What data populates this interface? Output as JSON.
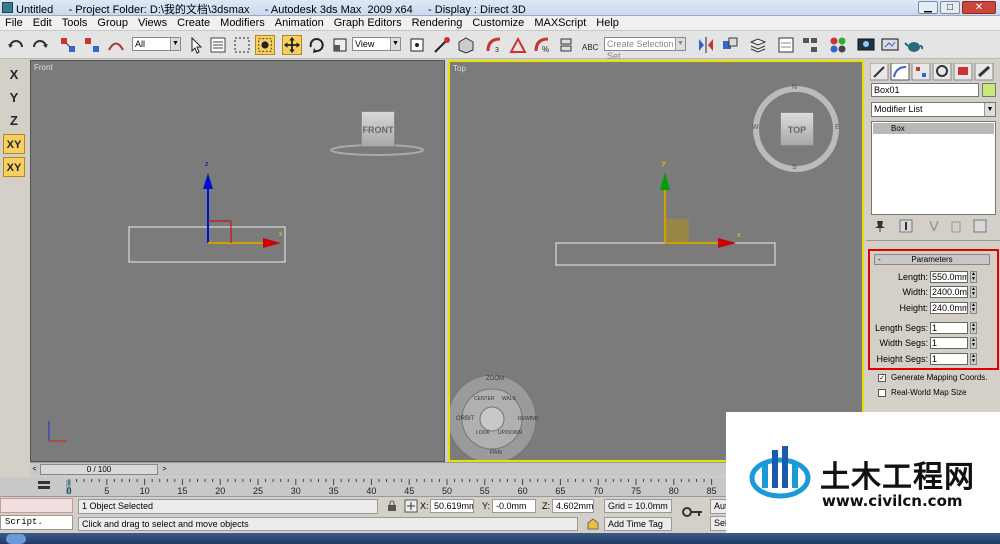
{
  "window": {
    "title": "Untitled     - Project Folder: D:\\我的文档\\3dsmax     - Autodesk 3ds Max  2009 x64     - Display : Direct 3D"
  },
  "menu": [
    "File",
    "Edit",
    "Tools",
    "Group",
    "Views",
    "Create",
    "Modifiers",
    "Animation",
    "Graph Editors",
    "Rendering",
    "Customize",
    "MAXScript",
    "Help"
  ],
  "toolbar": {
    "filter_value": "All",
    "ref_coord_value": "View",
    "named_selection_placeholder": "Create Selection Set"
  },
  "axis_constraints": [
    "X",
    "Y",
    "Z",
    "XY",
    "XY"
  ],
  "viewports": {
    "front": {
      "label": "Front",
      "cube_label": "FRONT",
      "axis_x": "x",
      "axis_z": "z"
    },
    "top": {
      "label": "Top",
      "cube_label": "TOP",
      "compass": [
        "N",
        "E",
        "S",
        "W"
      ],
      "axis_x": "x",
      "axis_y": "y"
    }
  },
  "steering_wheel": {
    "items": [
      "ZOOM",
      "ORBIT",
      "CENTER",
      "WALK",
      "REWIND",
      "LOOK",
      "UP/DOWN",
      "PAN"
    ]
  },
  "command_panel": {
    "object_name": "Box01",
    "object_color": "#c8e87a",
    "modifier_list_label": "Modifier List",
    "stack_item": "Box",
    "rollout_title": "Parameters",
    "rollout_toggle": "-",
    "params": [
      {
        "label": "Length:",
        "value": "550.0mm"
      },
      {
        "label": "Width:",
        "value": "2400.0mm"
      },
      {
        "label": "Height:",
        "value": "240.0mm"
      }
    ],
    "segs": [
      {
        "label": "Length Segs:",
        "value": "1"
      },
      {
        "label": "Width Segs:",
        "value": "1"
      },
      {
        "label": "Height Segs:",
        "value": "1"
      }
    ],
    "checkboxes": [
      {
        "label": "Generate Mapping Coords.",
        "checked": true
      },
      {
        "label": "Real-World Map Size",
        "checked": false
      }
    ],
    "highlight_color": "#e00000"
  },
  "timeline": {
    "frame_counter": "0 / 100",
    "ticks": [
      "0",
      "5",
      "10",
      "15",
      "20",
      "25",
      "30",
      "35",
      "40",
      "45",
      "50",
      "55",
      "60",
      "65",
      "70",
      "75",
      "80",
      "85"
    ]
  },
  "status": {
    "maxscript_label": "Script.",
    "selection_text": "1 Object Selected",
    "prompt_text": "Click and drag to select and move objects",
    "x_label": "X:",
    "x_value": "50.619mm",
    "y_label": "Y:",
    "y_value": "-0.0mm",
    "z_label": "Z:",
    "z_value": "4.602mm",
    "grid": "Grid = 10.0mm",
    "add_time_tag": "Add Time Tag",
    "auto_key_partial": "Auto",
    "set_key_partial": "Sel"
  },
  "watermark": {
    "name": "土木工程网",
    "url": "www.civilcn.com"
  },
  "colors": {
    "viewport_bg": "#7b7b7b",
    "active_border": "#e8e000",
    "axis_x": "#d00000",
    "axis_y": "#00a000",
    "axis_z": "#0010d0"
  }
}
